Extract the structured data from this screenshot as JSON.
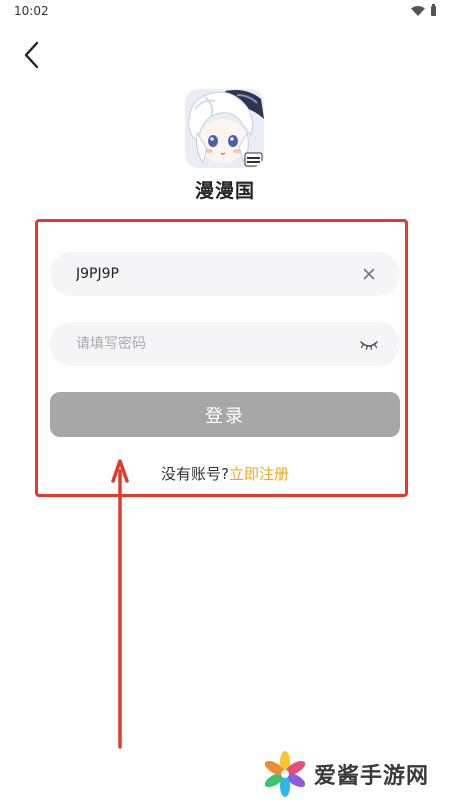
{
  "status_bar": {
    "time": "10:02"
  },
  "app": {
    "name": "漫漫国"
  },
  "form": {
    "account_value": "J9PJ9P",
    "password_placeholder": "请填写密码",
    "login_label": "登录"
  },
  "register": {
    "prompt": "没有账号?",
    "link_label": "立即注册"
  },
  "colors": {
    "annotation_red": "#e23b2e",
    "register_accent": "#f5a623",
    "login_button_bg": "#a7a7a7"
  },
  "icons": {
    "back": "chevron-left-icon",
    "clear": "close-icon",
    "password_toggle": "eye-closed-icon"
  },
  "watermark": {
    "text": "爱酱手游网"
  }
}
